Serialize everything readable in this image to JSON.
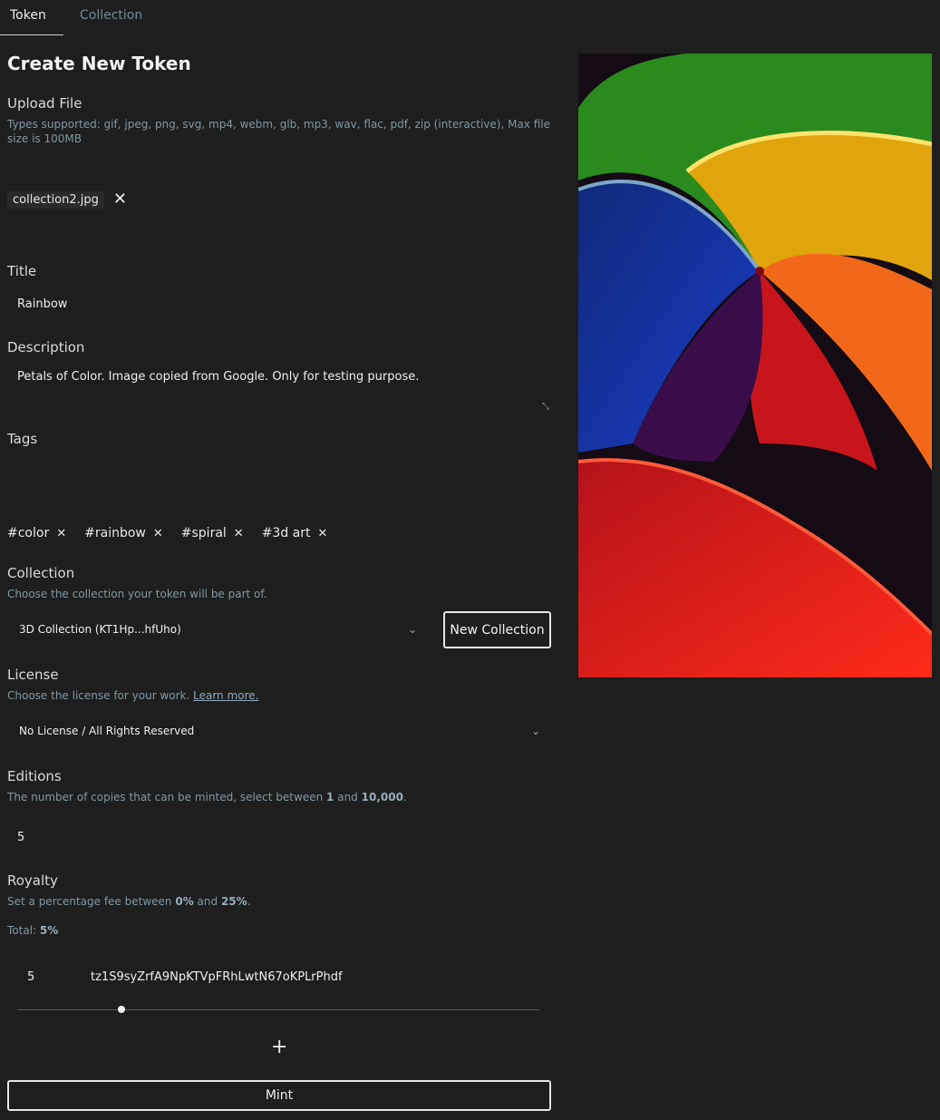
{
  "tabs": [
    {
      "label": "Token"
    },
    {
      "label": "Collection"
    }
  ],
  "page_title": "Create New Token",
  "upload": {
    "label": "Upload File",
    "hint": "Types supported: gif, jpeg, png, svg, mp4, webm, glb, mp3, wav, flac, pdf, zip (interactive), Max file size is 100MB",
    "file_name": "collection2.jpg"
  },
  "title": {
    "label": "Title",
    "value": "Rainbow"
  },
  "description": {
    "label": "Description",
    "value": "Petals of Color. Image copied from Google. Only for testing purpose."
  },
  "tags": {
    "label": "Tags",
    "items": [
      "#color",
      "#rainbow",
      "#spiral",
      "#3d art"
    ]
  },
  "collection": {
    "label": "Collection",
    "hint": "Choose the collection your token will be part of.",
    "selected": "3D Collection (KT1Hp...hfUho)",
    "new_button": "New Collection"
  },
  "license": {
    "label": "License",
    "hint_prefix": "Choose the license for your work.",
    "hint_link": "Learn more.",
    "selected": "No License / All Rights Reserved"
  },
  "editions": {
    "label": "Editions",
    "hint_prefix": "The number of copies that can be minted, select between",
    "min": "1",
    "and": "and",
    "max": "10,000",
    "value": "5"
  },
  "royalty": {
    "label": "Royalty",
    "hint_prefix": "Set a percentage fee between",
    "min": "0%",
    "and": "and",
    "max": "25%",
    "total_label": "Total:",
    "total_value": "5%",
    "row_value": "5",
    "row_address": "tz1S9syZrfA9NpKTVpFRhLwtN67oKPLrPhdf",
    "slider_fraction": 0.2
  },
  "mint_button": "Mint",
  "colors": {
    "background": "#1e1e1e",
    "hint": "#7f98a6",
    "text": "#e8e8e8"
  }
}
